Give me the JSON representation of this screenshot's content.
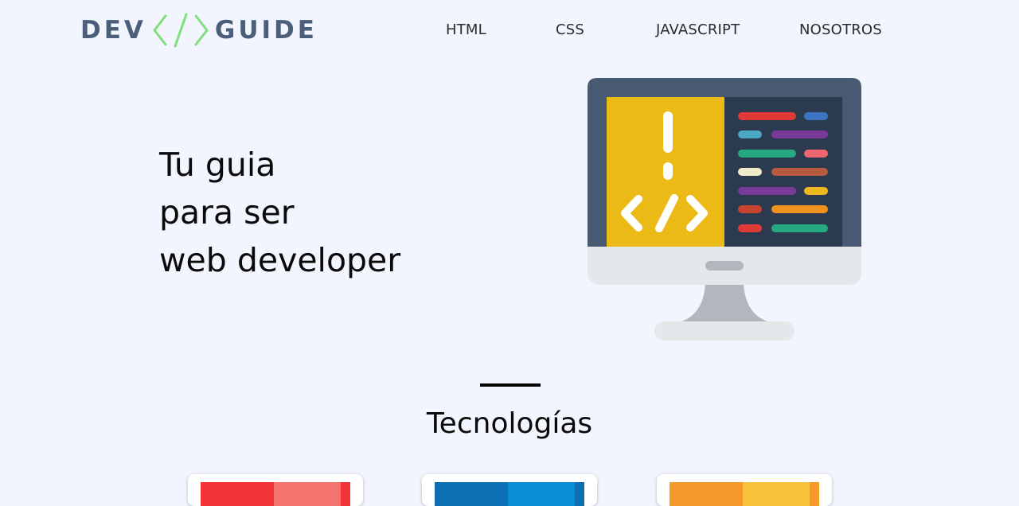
{
  "logo": {
    "left_word": "DEV",
    "right_word": "GUIDE",
    "code_icon": "code-brackets-icon",
    "word_color": "#4b5f7a",
    "accent_color": "#7ee07a"
  },
  "nav": {
    "items": [
      "HTML",
      "CSS",
      "JAVASCRIPT",
      "NOSOTROS"
    ]
  },
  "hero": {
    "lines": [
      "Tu guia",
      "para ser",
      "web developer"
    ],
    "illustration": "monitor-code-icon"
  },
  "technologies": {
    "title": "Tecnologías",
    "cards": [
      {
        "icon": "html5-icon",
        "color": "#f2333a",
        "highlight": "#f5736f"
      },
      {
        "icon": "css3-icon",
        "color": "#0c6fb3",
        "highlight": "#0a8fd6"
      },
      {
        "icon": "javascript-icon",
        "color": "#f39a2b",
        "highlight": "#f8c13a"
      }
    ]
  }
}
